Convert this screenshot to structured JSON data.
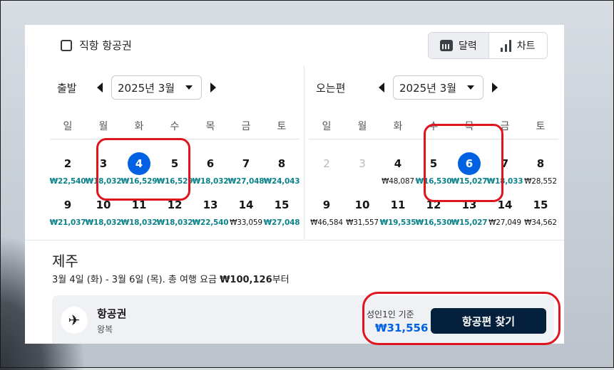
{
  "filters": {
    "direct_only_label": "직항 항공권"
  },
  "view_toggle": {
    "calendar_label": "달력",
    "chart_label": "차트"
  },
  "departure": {
    "label": "출발",
    "month": "2025년 3월",
    "weekdays": [
      "일",
      "월",
      "화",
      "수",
      "목",
      "금",
      "토"
    ],
    "days": [
      {
        "day": "2",
        "price": "₩22,540",
        "style": "green"
      },
      {
        "day": "3",
        "price": "₩18,032",
        "style": "green"
      },
      {
        "day": "4",
        "price": "₩16,529",
        "style": "green",
        "selected": true
      },
      {
        "day": "5",
        "price": "₩16,529",
        "style": "green"
      },
      {
        "day": "6",
        "price": "₩18,032",
        "style": "green"
      },
      {
        "day": "7",
        "price": "₩27,048",
        "style": "green"
      },
      {
        "day": "8",
        "price": "₩24,043",
        "style": "green"
      },
      {
        "day": "9",
        "price": "₩21,037",
        "style": "green"
      },
      {
        "day": "10",
        "price": "₩18,032",
        "style": "green"
      },
      {
        "day": "11",
        "price": "₩18,032",
        "style": "green"
      },
      {
        "day": "12",
        "price": "₩18,032",
        "style": "green"
      },
      {
        "day": "13",
        "price": "₩22,540",
        "style": "green"
      },
      {
        "day": "14",
        "price": "₩33,059",
        "style": "dark"
      },
      {
        "day": "15",
        "price": "₩27,048",
        "style": "green"
      }
    ]
  },
  "return": {
    "label": "오는편",
    "month": "2025년 3월",
    "weekdays": [
      "일",
      "월",
      "화",
      "수",
      "목",
      "금",
      "토"
    ],
    "days": [
      {
        "day": "2",
        "price": "",
        "style": "dim"
      },
      {
        "day": "3",
        "price": "",
        "style": "dim"
      },
      {
        "day": "4",
        "price": "₩48,087",
        "style": "dark"
      },
      {
        "day": "5",
        "price": "₩16,530",
        "style": "green"
      },
      {
        "day": "6",
        "price": "₩15,027",
        "style": "green",
        "selected": true
      },
      {
        "day": "7",
        "price": "₩18,033",
        "style": "green"
      },
      {
        "day": "8",
        "price": "₩28,552",
        "style": "dark"
      },
      {
        "day": "9",
        "price": "₩46,584",
        "style": "dark"
      },
      {
        "day": "10",
        "price": "₩31,557",
        "style": "dark"
      },
      {
        "day": "11",
        "price": "₩19,535",
        "style": "green"
      },
      {
        "day": "12",
        "price": "₩16,530",
        "style": "green"
      },
      {
        "day": "13",
        "price": "₩15,027",
        "style": "green"
      },
      {
        "day": "14",
        "price": "₩27,049",
        "style": "dark"
      },
      {
        "day": "15",
        "price": "₩34,562",
        "style": "dark"
      }
    ]
  },
  "result": {
    "destination": "제주",
    "summary_prefix": "3월 4일 (화) - 3월 6일 (목). 총 여행 요금 ",
    "summary_total": "₩100,126",
    "summary_suffix": "부터",
    "card_title": "항공권",
    "card_sub": "왕복",
    "basis": "성인1인 기준",
    "price": "₩31,556",
    "button": "항공편 찾기"
  },
  "colors": {
    "accent": "#0062e3",
    "price_green": "#0c838a",
    "button_bg": "#05203c",
    "highlight": "#e0141e"
  },
  "icons": {
    "calendar": "calendar-icon",
    "chart": "bar-chart-icon",
    "plane": "airplane-icon"
  }
}
